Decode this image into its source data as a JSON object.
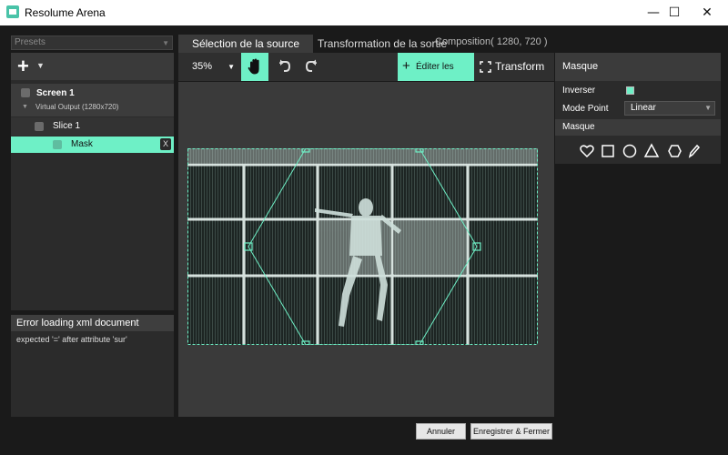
{
  "window": {
    "title": "Resolume Arena",
    "minimize": "—",
    "maximize": "☐",
    "close": "✕"
  },
  "left": {
    "presets_placeholder": "Presets",
    "add_icon": "+",
    "tree": {
      "screen_label": "Screen 1",
      "output_label": "Virtual Output (1280x720)",
      "slice_label": "Slice 1",
      "mask_label": "Mask",
      "remove_label": "X"
    },
    "error": {
      "title": "Error loading xml document",
      "message": "expected '=' after attribute 'sur'"
    }
  },
  "tabs": [
    {
      "label": "Sélection de la source"
    },
    {
      "label": "Transformation de la sortie"
    }
  ],
  "composition_label": "Composition( 1280, 720 )",
  "toolbar": {
    "zoom": "35%",
    "edit_points_label": "Éditer les points",
    "transform_label": "Transform"
  },
  "right": {
    "header": "Masque",
    "inverser_label": "Inverser",
    "inverser_checked": true,
    "mode_point_label": "Mode Point",
    "mode_point_value": "Linear",
    "shapes_header": "Masque",
    "shape_tools": [
      "heart-icon",
      "square-icon",
      "circle-icon",
      "triangle-icon",
      "hexagon-icon",
      "pencil-icon"
    ]
  },
  "footer": {
    "cancel_label": "Annuler",
    "save_label": "Enregistrer & Fermer"
  },
  "colors": {
    "accent": "#6ef0c6",
    "panel": "#2b2b2b",
    "background": "#1a1a1a"
  }
}
